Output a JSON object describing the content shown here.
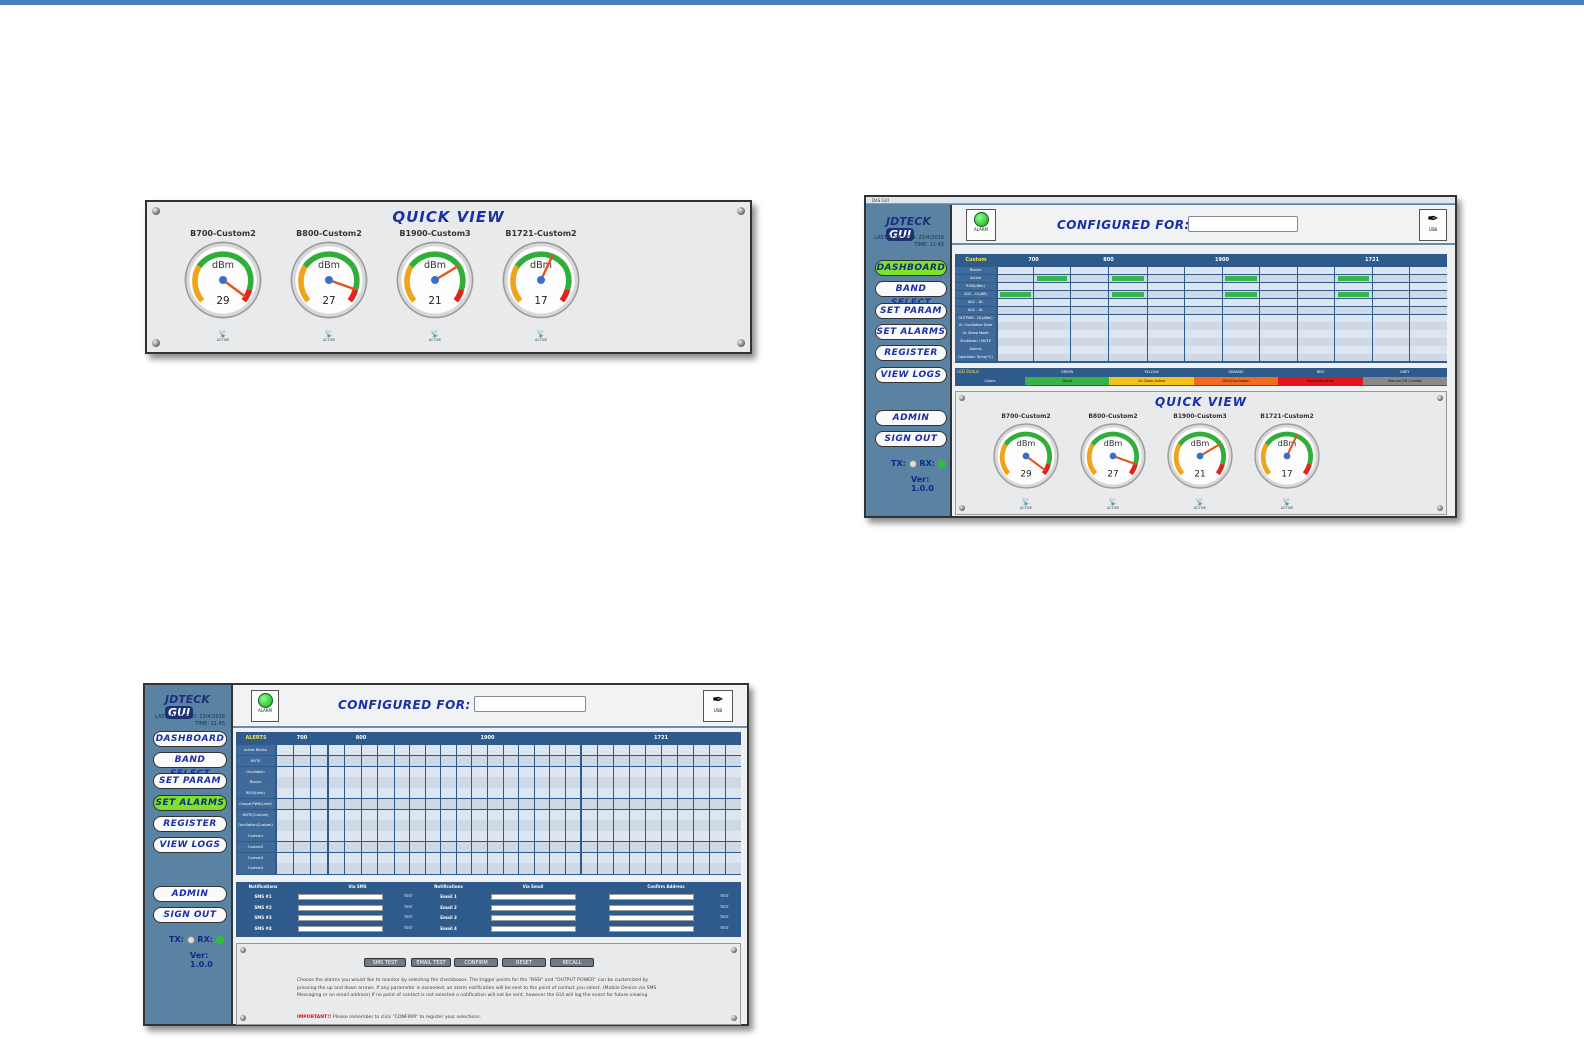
{
  "quick_view_panel": {
    "title": "QUICK VIEW",
    "gauges": [
      {
        "name": "B700-Custom2",
        "unit": "dBm",
        "value": "29",
        "status": "ACTIVE"
      },
      {
        "name": "B800-Custom2",
        "unit": "dBm",
        "value": "27",
        "status": "ACTIVE"
      },
      {
        "name": "B1900-Custom3",
        "unit": "dBm",
        "value": "21",
        "status": "ACTIVE"
      },
      {
        "name": "B1721-Custom2",
        "unit": "dBm",
        "value": "17",
        "status": "ACTIVE"
      }
    ]
  },
  "dashboard_window": {
    "window_title": "DAS GUI",
    "logo_main": "JDTECK",
    "logo_sub": "GUI",
    "last_accessed": "LAST ACCESSED: 23/4/2016",
    "time": "TIME: 11:45",
    "nav": [
      "DASHBOARD",
      "BAND SELECT",
      "SET PARAM",
      "SET ALARMS",
      "REGISTER",
      "VIEW LOGS"
    ],
    "nav_active": "DASHBOARD",
    "admin": "ADMIN",
    "sign_out": "SIGN OUT",
    "tx": "TX:",
    "rx": "RX:",
    "version": "Ver: 1.0.0",
    "alarm_label": "ALARM",
    "configured_for": "CONFIGURED FOR:",
    "usb_label": "USB",
    "band_headers": [
      "Custom",
      "700",
      "800",
      "1900",
      "1721"
    ],
    "row_labels": [
      "Blocks",
      "Active",
      "RSSI(dBm)",
      "AGC - UL(dB)",
      "AGC - DL",
      "AGC - UL",
      "OUTPWR - DL(dBm)",
      "UL Oscillation Dete",
      "UL Sleep Mode",
      "Shutdown / MUTE",
      "Alarms",
      "Operation Temp(°C)"
    ],
    "legend_title": "LED Status",
    "legend": [
      {
        "name": "GREEN",
        "desc": "Good",
        "color": "#35b548"
      },
      {
        "name": "YELLOW",
        "desc": "UL Sleep Active",
        "color": "#f6c21a"
      },
      {
        "name": "ORANGE",
        "desc": "DSO/Oscillation",
        "color": "#f26b21"
      },
      {
        "name": "RED",
        "desc": "Shutdown/Mute",
        "color": "#e3141b"
      },
      {
        "name": "GREY",
        "desc": "Manual Off / Inhibit",
        "color": "#8a8a8a"
      }
    ],
    "legend_first": "Colors",
    "quick_view_title": "QUICK VIEW",
    "gauges": [
      {
        "name": "B700-Custom2",
        "unit": "dBm",
        "value": "29",
        "status": "ACTIVE"
      },
      {
        "name": "B800-Custom2",
        "unit": "dBm",
        "value": "27",
        "status": "ACTIVE"
      },
      {
        "name": "B1900-Custom3",
        "unit": "dBm",
        "value": "21",
        "status": "ACTIVE"
      },
      {
        "name": "B1721-Custom2",
        "unit": "dBm",
        "value": "17",
        "status": "ACTIVE"
      }
    ]
  },
  "alarms_window": {
    "logo_main": "JDTECK",
    "logo_sub": "GUI",
    "last_accessed": "LAST ACCESSED: 23/4/2016",
    "time": "TIME: 11:45",
    "nav": [
      "DASHBOARD",
      "BAND SELECT",
      "SET PARAM",
      "SET ALARMS",
      "REGISTER",
      "VIEW LOGS"
    ],
    "nav_active": "SET ALARMS",
    "admin": "ADMIN",
    "sign_out": "SIGN OUT",
    "tx": "TX:",
    "rx": "RX:",
    "version": "Ver: 1.0.0",
    "alarm_label": "ALARM",
    "configured_for": "CONFIGURED FOR:",
    "usb_label": "USB",
    "band_headers": [
      "ALERTS",
      "700",
      "800",
      "1900",
      "1721"
    ],
    "row_labels": [
      "Active Blocks",
      "MUTE",
      "Oscillation",
      "Blocks",
      "RSSI(Limit)",
      "Output PWR(Limit)",
      "MUTE(Custom)",
      "Oscillation(Custom)",
      "Custom1",
      "Custom2",
      "Custom3",
      "Custom4"
    ],
    "notif_headers": [
      "Notifications",
      "Via SMS",
      "Notifications",
      "Via Email",
      "Confirm Address"
    ],
    "sms_rows": [
      "SMS #1",
      "SMS #2",
      "SMS #3",
      "SMS #4"
    ],
    "email_rows": [
      "Email 1",
      "Email 2",
      "Email 3",
      "Email 4"
    ],
    "test_label": "TEST",
    "buttons": [
      "SMS TEST",
      "EMAIL TEST",
      "CONFIRM",
      "RESET",
      "RECALL"
    ],
    "help_text": "Choose the alarms you would like to monitor by selecting the checkboxes. The trigger points for the \"RSSI\" and \"OUTPUT POWER\" can be customized by pressing the up and down arrows. If any parameter is exceeded, an alarm notification will be sent to the point of contact you select. (Mobile Device via SMS Messaging or an email address) If no point of contact is not selected a notification will not be sent, however the GUI will log the event for future viewing.",
    "important_label": "IMPORTANT!!",
    "important_text": " Please remember to click \"CONFIRM\" to register your selections."
  }
}
